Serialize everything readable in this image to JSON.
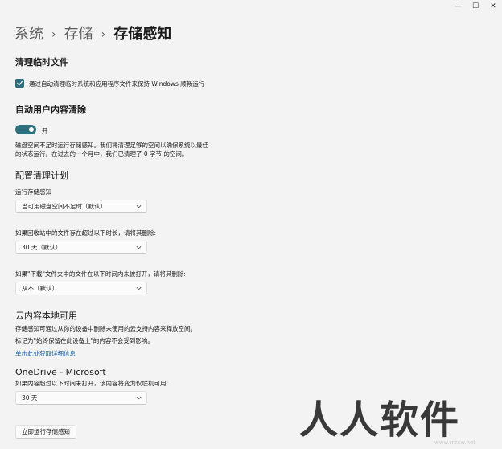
{
  "window": {
    "minimize_glyph": "—",
    "maximize_glyph": "☐",
    "close_glyph": "✕"
  },
  "breadcrumb": {
    "items": [
      "系统",
      "存储",
      "存储感知"
    ],
    "separator": "›"
  },
  "cleanup_temp": {
    "heading": "清理临时文件",
    "checkbox_label": "通过自动清理临时系统和应用程序文件来保持 Windows 顺畅运行",
    "checked": true
  },
  "auto_user_content": {
    "heading": "自动用户内容清除",
    "toggle_state_label": "开",
    "toggle_on": true,
    "description_line1": "磁盘空间不足时运行存储感知。我们将清理足够的空间以确保系统以最佳",
    "description_line2": "的状态运行。在过去的一个月中，我们已清理了 0 字节 的空间。"
  },
  "schedule": {
    "heading": "配置清理计划",
    "run_label": "运行存储感知",
    "run_value": "当可用磁盘空间不足时（默认）",
    "recycle_label": "如果回收站中的文件存在超过以下时长，请将其删除:",
    "recycle_value": "30 天（默认）",
    "downloads_label": "如果\"下载\"文件夹中的文件在以下时间内未被打开，请将其删除:",
    "downloads_value": "从不（默认）"
  },
  "cloud": {
    "heading": "云内容本地可用",
    "line1": "存储感知可通过从你的设备中删除未使用的云支持内容来释放空间。",
    "line2": "标记为\"始终保留在此设备上\"的内容不会受到影响。",
    "link": "单击此处获取详细信息"
  },
  "onedrive": {
    "heading": "OneDrive - Microsoft",
    "label": "如果内容超过以下时间未打开，该内容将变为仅联机可用:",
    "value": "30 天"
  },
  "run_now_button": "立即运行存储感知",
  "watermark": {
    "text": "人人软件园",
    "url": "www.rrzxw.net"
  },
  "colors": {
    "accent": "#2e6f7e",
    "background": "#f3f3f3",
    "link": "#1b5fae"
  }
}
